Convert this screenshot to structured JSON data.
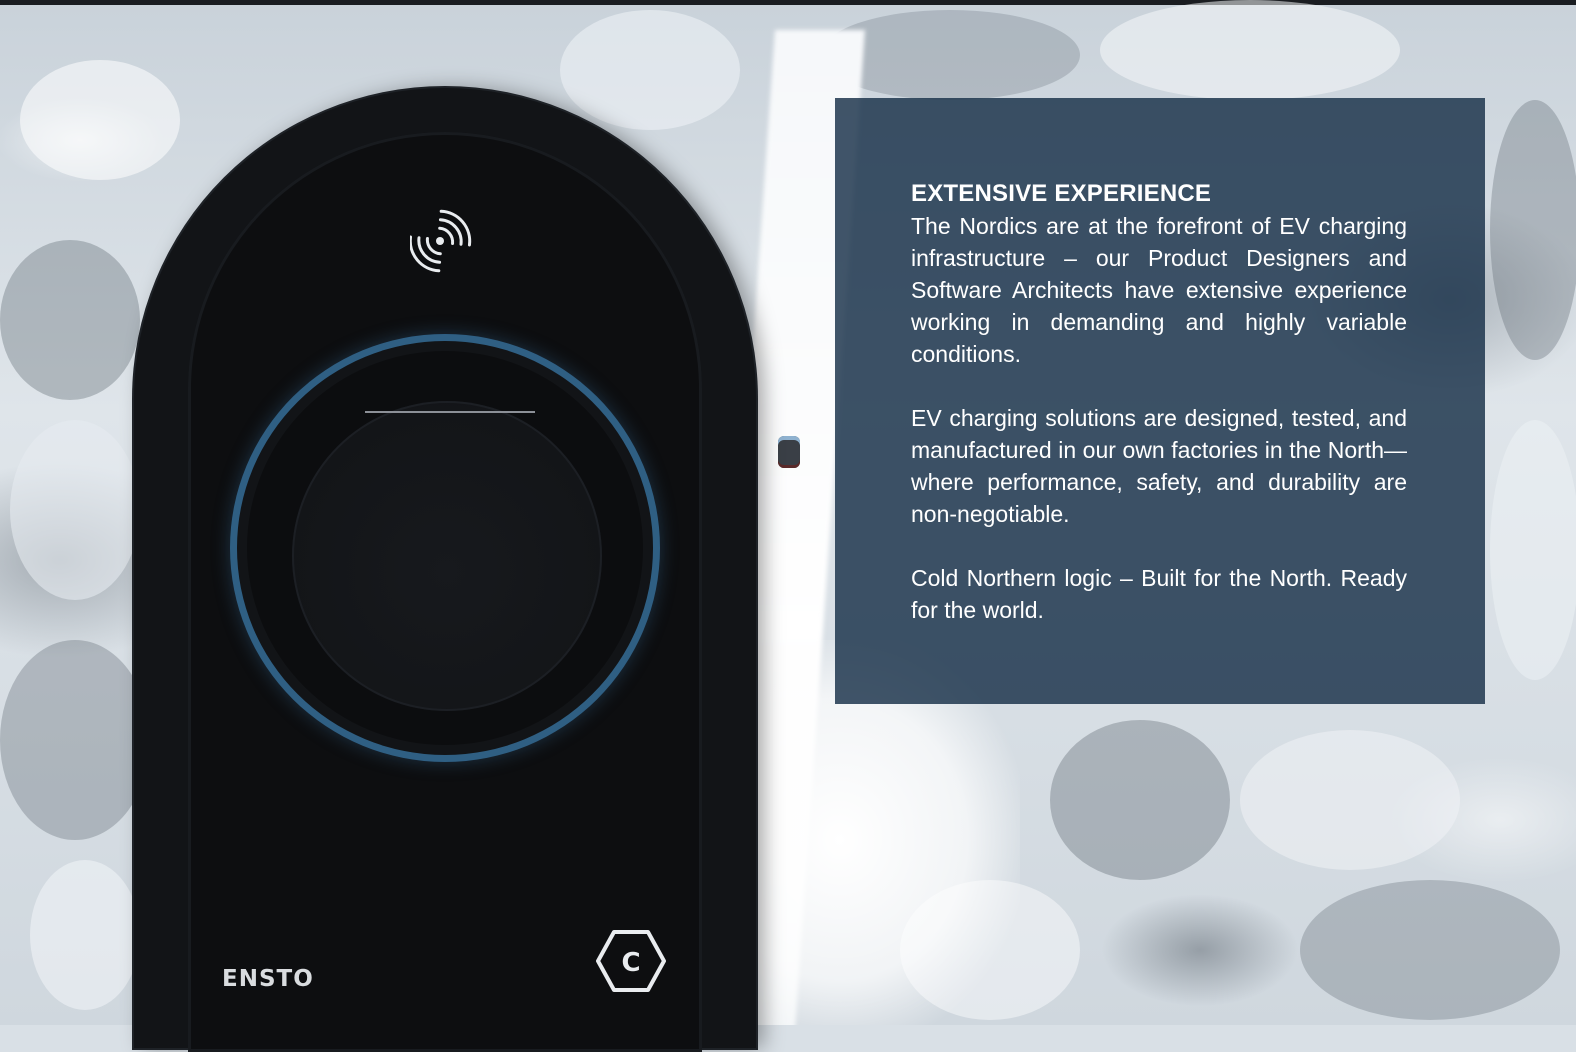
{
  "panel": {
    "title": "EXTENSIVE EXPERIENCE",
    "paragraph_1": "The Nordics are at the forefront of EV charging infrastructure – our Product Designers and Software Architects have extensive experience working in demanding and highly variable conditions.",
    "paragraph_2": "EV charging solutions are designed, tested, and manufactured in our own factories in the North—where performance, safety, and durability are non-negotiable.",
    "paragraph_3": "Cold Northern logic – Built for the North. Ready for the world."
  },
  "charger": {
    "brand": "ENSTO",
    "badge_letter": "C",
    "icon": "rfid-contactless-icon",
    "ring_color": "#2f5f83"
  },
  "colors": {
    "panel_background": "#173048",
    "charger_body": "#121417"
  }
}
